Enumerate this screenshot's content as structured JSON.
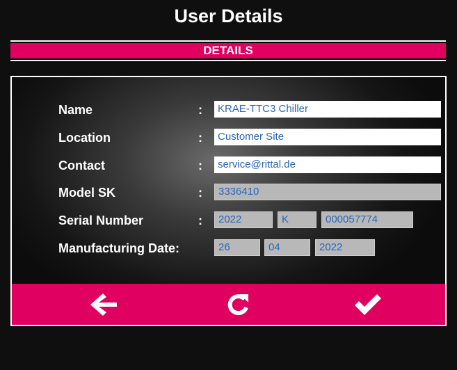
{
  "header": {
    "title": "User Details"
  },
  "section": {
    "title": "DETAILS"
  },
  "colon": ":",
  "form": {
    "name": {
      "label": "Name",
      "value": "KRAE-TTC3 Chiller"
    },
    "location": {
      "label": "Location",
      "value": "Customer Site"
    },
    "contact": {
      "label": "Contact",
      "value": "service@rittal.de"
    },
    "model": {
      "label": "Model SK",
      "value": "3336410"
    },
    "serial": {
      "label": "Serial Number",
      "year": "2022",
      "code": "K",
      "number": "000057774"
    },
    "manufacturing": {
      "label": "Manufacturing Date:",
      "day": "26",
      "month": "04",
      "year": "2022"
    }
  },
  "footer": {
    "icons": [
      "arrow-left-icon",
      "refresh-icon",
      "checkmark-icon"
    ]
  },
  "colors": {
    "accent": "#e0005f",
    "value_text": "#2a67b8"
  }
}
